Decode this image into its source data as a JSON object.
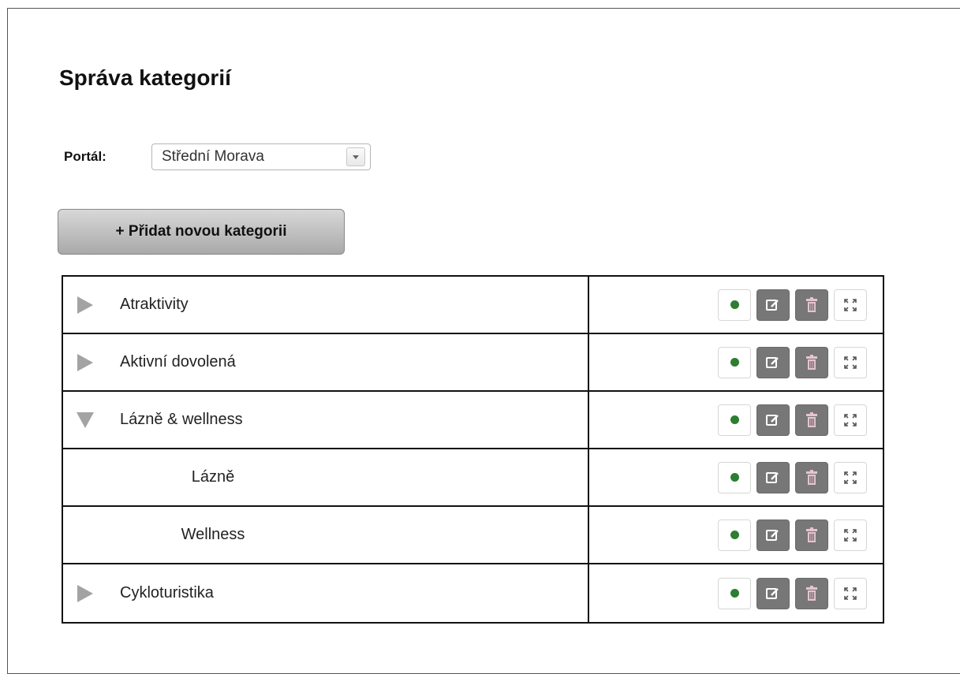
{
  "page": {
    "title": "Správa kategorií"
  },
  "portal": {
    "label": "Portál:",
    "selected": "Střední Morava"
  },
  "toolbar": {
    "add_label": "+ Přidat novou kategorii"
  },
  "colors": {
    "status_active": "#2e7d32",
    "action_button_bg": "#777777",
    "toggle_arrow": "#a3a3a3"
  },
  "categories": [
    {
      "label": "Atraktivity",
      "level": 0,
      "toggle": "collapsed",
      "status": "active"
    },
    {
      "label": "Aktivní dovolená",
      "level": 0,
      "toggle": "collapsed",
      "status": "active"
    },
    {
      "label": "Lázně & wellness",
      "level": 0,
      "toggle": "expanded",
      "status": "active"
    },
    {
      "label": "Lázně",
      "level": 1,
      "toggle": "none",
      "status": "active"
    },
    {
      "label": "Wellness",
      "level": 1,
      "toggle": "none",
      "status": "active"
    },
    {
      "label": "Cykloturistika",
      "level": 0,
      "toggle": "collapsed",
      "status": "active"
    }
  ],
  "icons": {
    "status": "status-dot-icon",
    "edit": "edit-icon",
    "delete": "trash-icon",
    "expand": "expand-icon",
    "collapsed": "caret-right-icon",
    "expanded": "caret-down-icon",
    "dropdown": "chevron-down-icon"
  }
}
